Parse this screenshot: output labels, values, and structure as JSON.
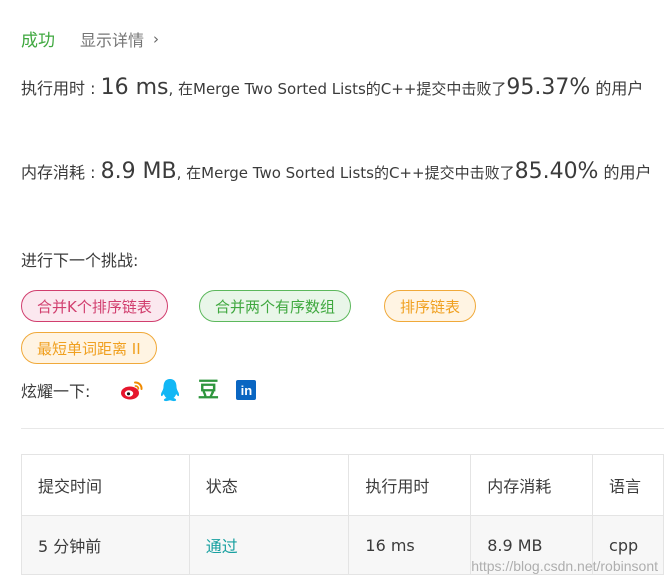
{
  "status": {
    "label": "成功",
    "details_label": "显示详情",
    "details_chevron": "›"
  },
  "runtime": {
    "label": "执行用时 : ",
    "value": "16 ms",
    "mid_text": ", 在Merge Two Sorted Lists的C++提交中击败了",
    "percent": "95.37%",
    "suffix": " 的用户"
  },
  "memory": {
    "label": "内存消耗 : ",
    "value": "8.9 MB",
    "mid_text": ", 在Merge Two Sorted Lists的C++提交中击败了",
    "percent": "85.40%",
    "suffix": " 的用户"
  },
  "challenge": {
    "title": "进行下一个挑战:",
    "tags": [
      {
        "label": "合并K个排序链表",
        "difficulty": "hard"
      },
      {
        "label": "合并两个有序数组",
        "difficulty": "easy"
      },
      {
        "label": "排序链表",
        "difficulty": "medium"
      },
      {
        "label": "最短单词距离 II",
        "difficulty": "medium"
      }
    ]
  },
  "share": {
    "label": "炫耀一下:",
    "icons": [
      "weibo-icon",
      "qq-icon",
      "douban-icon",
      "linkedin-icon"
    ],
    "douban_glyph": "豆",
    "linkedin_glyph": "in"
  },
  "table": {
    "headers": [
      "提交时间",
      "状态",
      "执行用时",
      "内存消耗",
      "语言"
    ],
    "rows": [
      {
        "time": "5 分钟前",
        "status": "通过",
        "runtime": "16 ms",
        "memory": "8.9 MB",
        "language": "cpp"
      }
    ]
  },
  "watermark": "https://blog.csdn.net/robinsont",
  "colors": {
    "success": "#3fa83f",
    "hard": "#d13e6e",
    "easy": "#5cb85c",
    "medium": "#f0a93a",
    "accepted": "#18a0a0"
  }
}
